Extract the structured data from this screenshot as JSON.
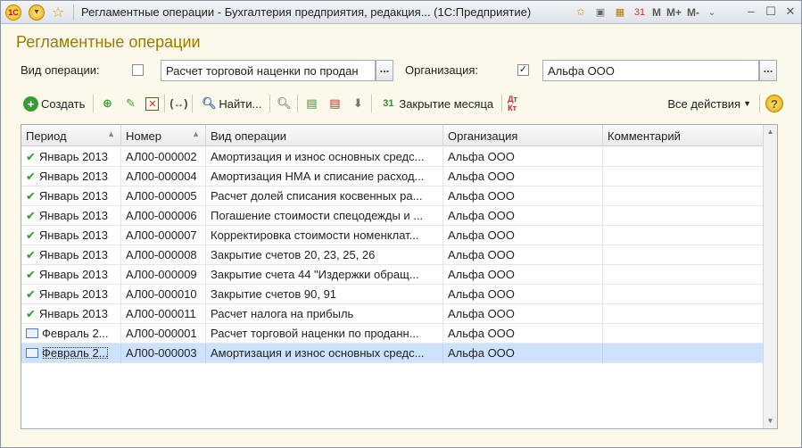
{
  "window": {
    "title": "Регламентные операции - Бухгалтерия предприятия, редакция... (1С:Предприятие)",
    "logo_text": "1С",
    "toolbar_right": [
      "M",
      "M+",
      "M-"
    ]
  },
  "form": {
    "heading": "Регламентные операции",
    "filter": {
      "op_label": "Вид операции:",
      "op_checked": false,
      "op_value": "Расчет торговой наценки по продан",
      "org_label": "Организация:",
      "org_checked": true,
      "org_value": "Альфа ООО",
      "select_btn": "..."
    }
  },
  "toolbar": {
    "create": "Создать",
    "find": "Найти...",
    "close_month": "Закрытие месяца",
    "dt_kt": "Дт Кт",
    "all_actions": "Все действия",
    "help": "?"
  },
  "table": {
    "columns": [
      "Период",
      "Номер",
      "Вид операции",
      "Организация",
      "Комментарий"
    ],
    "rows": [
      {
        "status": "posted",
        "period": "Январь 2013",
        "number": "АЛ00-000002",
        "op": "Амортизация и износ основных средс...",
        "org": "Альфа ООО",
        "comment": ""
      },
      {
        "status": "posted",
        "period": "Январь 2013",
        "number": "АЛ00-000004",
        "op": "Амортизация НМА и списание расход...",
        "org": "Альфа ООО",
        "comment": ""
      },
      {
        "status": "posted",
        "period": "Январь 2013",
        "number": "АЛ00-000005",
        "op": "Расчет долей списания косвенных ра...",
        "org": "Альфа ООО",
        "comment": ""
      },
      {
        "status": "posted",
        "period": "Январь 2013",
        "number": "АЛ00-000006",
        "op": "Погашение стоимости спецодежды и ...",
        "org": "Альфа ООО",
        "comment": ""
      },
      {
        "status": "posted",
        "period": "Январь 2013",
        "number": "АЛ00-000007",
        "op": "Корректировка стоимости номенклат...",
        "org": "Альфа ООО",
        "comment": ""
      },
      {
        "status": "posted",
        "period": "Январь 2013",
        "number": "АЛ00-000008",
        "op": "Закрытие счетов 20, 23, 25, 26",
        "org": "Альфа ООО",
        "comment": ""
      },
      {
        "status": "posted",
        "period": "Январь 2013",
        "number": "АЛ00-000009",
        "op": "Закрытие счета 44 \"Издержки обращ...",
        "org": "Альфа ООО",
        "comment": ""
      },
      {
        "status": "posted",
        "period": "Январь 2013",
        "number": "АЛ00-000010",
        "op": "Закрытие счетов 90, 91",
        "org": "Альфа ООО",
        "comment": ""
      },
      {
        "status": "posted",
        "period": "Январь 2013",
        "number": "АЛ00-000011",
        "op": "Расчет налога на прибыль",
        "org": "Альфа ООО",
        "comment": ""
      },
      {
        "status": "draft",
        "period": "Февраль 2...",
        "number": "АЛ00-000001",
        "op": "Расчет торговой наценки по проданн...",
        "org": "Альфа ООО",
        "comment": ""
      },
      {
        "status": "draft",
        "period": "Февраль 2...",
        "number": "АЛ00-000003",
        "op": "Амортизация и износ основных средс...",
        "org": "Альфа ООО",
        "comment": "",
        "selected": true
      }
    ]
  },
  "colors": {
    "heading": "#9a7a00",
    "selected_row": "#cde3fb",
    "posted_check": "#2a9a2a"
  }
}
